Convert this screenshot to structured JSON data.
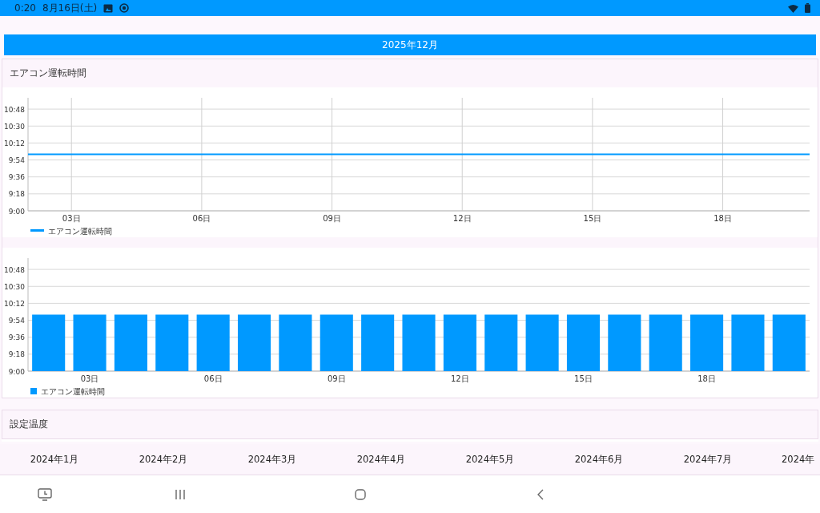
{
  "status_bar": {
    "time": "0:20",
    "date": "8月16日(土)"
  },
  "month_banner": {
    "label": "2025年12月"
  },
  "sections": [
    {
      "title": "エアコン運転時間",
      "charts": [
        {
          "chart_data": {
            "type": "line",
            "grid": true,
            "x": [
              2,
              3,
              4,
              5,
              6,
              7,
              8,
              9,
              10,
              11,
              12,
              13,
              14,
              15,
              16,
              17,
              18,
              19,
              20
            ],
            "series": [
              {
                "name": "エアコン運転時間",
                "color": "#0099ff",
                "values": [
                  600,
                  600,
                  600,
                  600,
                  600,
                  600,
                  600,
                  600,
                  600,
                  600,
                  600,
                  600,
                  600,
                  600,
                  600,
                  600,
                  600,
                  600,
                  600
                ]
              }
            ],
            "xlim": [
              2,
              20
            ],
            "ylim": [
              540,
              660
            ],
            "yticks": [
              {
                "value": 540,
                "label": "9:00"
              },
              {
                "value": 558,
                "label": "9:18"
              },
              {
                "value": 576,
                "label": "9:36"
              },
              {
                "value": 594,
                "label": "9:54"
              },
              {
                "value": 612,
                "label": "10:12"
              },
              {
                "value": 630,
                "label": "10:30"
              },
              {
                "value": 648,
                "label": "10:48"
              }
            ],
            "xticks": [
              {
                "value": 3,
                "label": "03日"
              },
              {
                "value": 6,
                "label": "06日"
              },
              {
                "value": 9,
                "label": "09日"
              },
              {
                "value": 12,
                "label": "12日"
              },
              {
                "value": 15,
                "label": "15日"
              },
              {
                "value": 18,
                "label": "18日"
              }
            ]
          }
        },
        {
          "chart_data": {
            "type": "bar",
            "grid": true,
            "x": [
              2,
              3,
              4,
              5,
              6,
              7,
              8,
              9,
              10,
              11,
              12,
              13,
              14,
              15,
              16,
              17,
              18,
              19,
              20
            ],
            "series": [
              {
                "name": "エアコン運転時間",
                "color": "#0099ff",
                "values": [
                  600,
                  600,
                  600,
                  600,
                  600,
                  600,
                  600,
                  600,
                  600,
                  600,
                  600,
                  600,
                  600,
                  600,
                  600,
                  600,
                  600,
                  600,
                  600
                ]
              }
            ],
            "xlim": [
              1.5,
              20.5
            ],
            "ylim": [
              540,
              660
            ],
            "yticks": [
              {
                "value": 540,
                "label": "9:00"
              },
              {
                "value": 558,
                "label": "9:18"
              },
              {
                "value": 576,
                "label": "9:36"
              },
              {
                "value": 594,
                "label": "9:54"
              },
              {
                "value": 612,
                "label": "10:12"
              },
              {
                "value": 630,
                "label": "10:30"
              },
              {
                "value": 648,
                "label": "10:48"
              }
            ],
            "xticks": [
              {
                "value": 3,
                "label": "03日"
              },
              {
                "value": 6,
                "label": "06日"
              },
              {
                "value": 9,
                "label": "09日"
              },
              {
                "value": 12,
                "label": "12日"
              },
              {
                "value": 15,
                "label": "15日"
              },
              {
                "value": 18,
                "label": "18日"
              }
            ]
          }
        }
      ]
    },
    {
      "title": "設定温度"
    }
  ],
  "month_tabs": [
    "2024年1月",
    "2024年2月",
    "2024年3月",
    "2024年4月",
    "2024年5月",
    "2024年6月",
    "2024年7月",
    "2024年"
  ]
}
